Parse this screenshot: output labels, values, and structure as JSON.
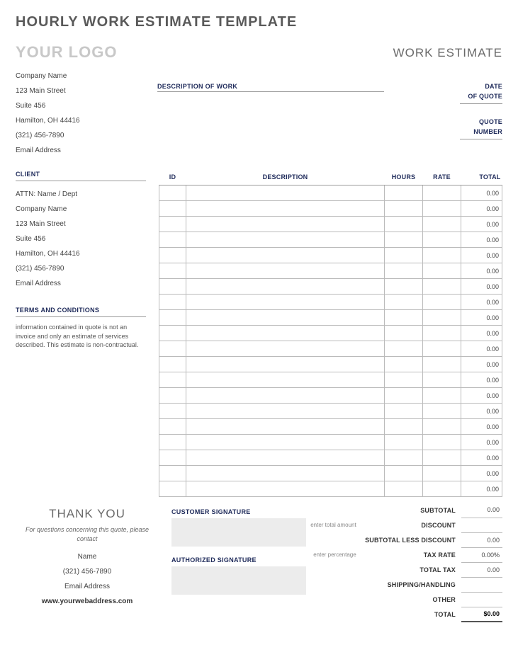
{
  "page_title": "HOURLY WORK ESTIMATE TEMPLATE",
  "logo_text": "YOUR LOGO",
  "doc_type_label": "WORK ESTIMATE",
  "company": {
    "name": "Company Name",
    "street": "123 Main Street",
    "suite": "Suite 456",
    "city": "Hamilton, OH  44416",
    "phone": "(321) 456-7890",
    "email": "Email Address"
  },
  "description_label": "DESCRIPTION OF WORK",
  "date_group": {
    "line1": "DATE",
    "line2": "OF QUOTE"
  },
  "quote_group": {
    "line1": "QUOTE",
    "line2": "NUMBER"
  },
  "client_header": "CLIENT",
  "client": {
    "attn": "ATTN: Name / Dept",
    "name": "Company Name",
    "street": "123 Main Street",
    "suite": "Suite 456",
    "city": "Hamilton, OH  44416",
    "phone": "(321) 456-7890",
    "email": "Email Address"
  },
  "terms_header": "TERMS AND CONDITIONS",
  "terms_text": "information contained in quote is not an invoice and only an estimate of services described. This estimate is non-contractual.",
  "columns": {
    "id": "ID",
    "desc": "DESCRIPTION",
    "hours": "HOURS",
    "rate": "RATE",
    "total": "TOTAL"
  },
  "rows": [
    {
      "id": "",
      "desc": "",
      "hours": "",
      "rate": "",
      "total": "0.00"
    },
    {
      "id": "",
      "desc": "",
      "hours": "",
      "rate": "",
      "total": "0.00"
    },
    {
      "id": "",
      "desc": "",
      "hours": "",
      "rate": "",
      "total": "0.00"
    },
    {
      "id": "",
      "desc": "",
      "hours": "",
      "rate": "",
      "total": "0.00"
    },
    {
      "id": "",
      "desc": "",
      "hours": "",
      "rate": "",
      "total": "0.00"
    },
    {
      "id": "",
      "desc": "",
      "hours": "",
      "rate": "",
      "total": "0.00"
    },
    {
      "id": "",
      "desc": "",
      "hours": "",
      "rate": "",
      "total": "0.00"
    },
    {
      "id": "",
      "desc": "",
      "hours": "",
      "rate": "",
      "total": "0.00"
    },
    {
      "id": "",
      "desc": "",
      "hours": "",
      "rate": "",
      "total": "0.00"
    },
    {
      "id": "",
      "desc": "",
      "hours": "",
      "rate": "",
      "total": "0.00"
    },
    {
      "id": "",
      "desc": "",
      "hours": "",
      "rate": "",
      "total": "0.00"
    },
    {
      "id": "",
      "desc": "",
      "hours": "",
      "rate": "",
      "total": "0.00"
    },
    {
      "id": "",
      "desc": "",
      "hours": "",
      "rate": "",
      "total": "0.00"
    },
    {
      "id": "",
      "desc": "",
      "hours": "",
      "rate": "",
      "total": "0.00"
    },
    {
      "id": "",
      "desc": "",
      "hours": "",
      "rate": "",
      "total": "0.00"
    },
    {
      "id": "",
      "desc": "",
      "hours": "",
      "rate": "",
      "total": "0.00"
    },
    {
      "id": "",
      "desc": "",
      "hours": "",
      "rate": "",
      "total": "0.00"
    },
    {
      "id": "",
      "desc": "",
      "hours": "",
      "rate": "",
      "total": "0.00"
    },
    {
      "id": "",
      "desc": "",
      "hours": "",
      "rate": "",
      "total": "0.00"
    },
    {
      "id": "",
      "desc": "",
      "hours": "",
      "rate": "",
      "total": "0.00"
    }
  ],
  "thank_you": {
    "title": "THANK YOU",
    "subtitle": "For questions concerning this quote, please contact",
    "name": "Name",
    "phone": "(321) 456-7890",
    "email": "Email Address",
    "web": "www.yourwebaddress.com"
  },
  "signatures": {
    "customer_label": "CUSTOMER SIGNATURE",
    "authorized_label": "AUTHORIZED SIGNATURE"
  },
  "totals": {
    "subtotal": {
      "label": "SUBTOTAL",
      "value": "0.00"
    },
    "discount": {
      "hint": "enter total amount",
      "label": "DISCOUNT",
      "value": ""
    },
    "sub_less": {
      "label": "SUBTOTAL LESS DISCOUNT",
      "value": "0.00"
    },
    "tax_rate": {
      "hint": "enter percentage",
      "label": "TAX RATE",
      "value": "0.00%"
    },
    "total_tax": {
      "label": "TOTAL TAX",
      "value": "0.00"
    },
    "shipping": {
      "label": "SHIPPING/HANDLING",
      "value": ""
    },
    "other": {
      "label": "OTHER",
      "value": ""
    },
    "grand": {
      "label": "TOTAL",
      "value": "$0.00"
    }
  }
}
